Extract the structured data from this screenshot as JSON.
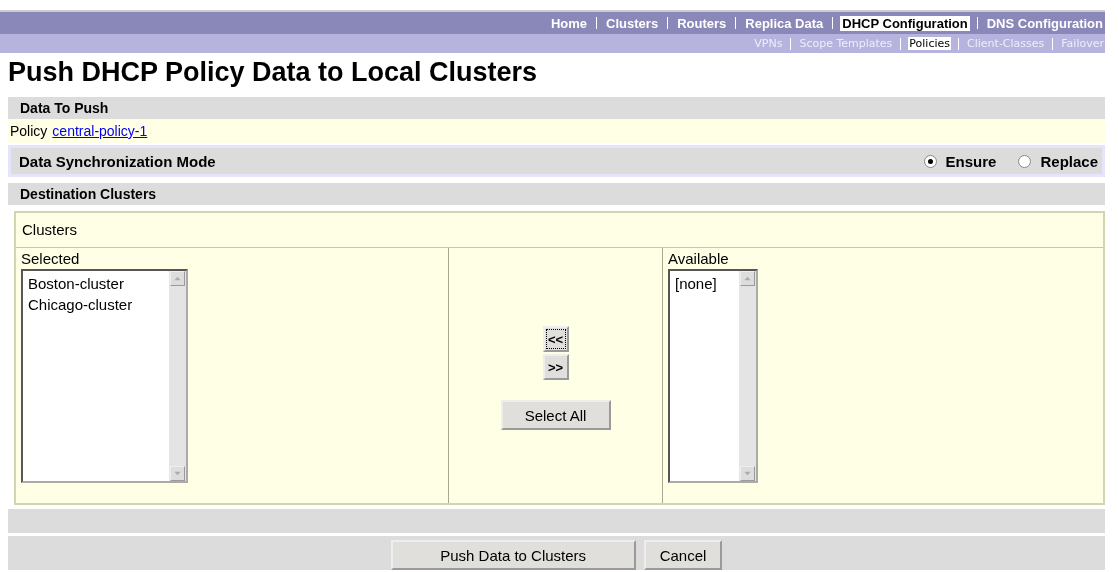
{
  "nav": {
    "items": [
      {
        "label": "Home",
        "selected": false
      },
      {
        "label": "Clusters",
        "selected": false
      },
      {
        "label": "Routers",
        "selected": false
      },
      {
        "label": "Replica Data",
        "selected": false
      },
      {
        "label": "DHCP Configuration",
        "selected": true
      },
      {
        "label": "DNS Configuration",
        "selected": false
      }
    ]
  },
  "subnav": {
    "items": [
      {
        "label": "VPNs",
        "selected": false
      },
      {
        "label": "Scope Templates",
        "selected": false
      },
      {
        "label": "Policies",
        "selected": true
      },
      {
        "label": "Client-Classes",
        "selected": false
      },
      {
        "label": "Failover",
        "selected": false
      }
    ]
  },
  "title": "Push DHCP Policy Data to Local Clusters",
  "data_section": {
    "header": "Data To Push",
    "label": "Policy",
    "link": "central-policy-1"
  },
  "sync_mode": {
    "header": "Data Synchronization Mode",
    "options": [
      {
        "label": "Ensure",
        "selected": true
      },
      {
        "label": "Replace",
        "selected": false
      }
    ]
  },
  "destination": {
    "header": "Destination Clusters",
    "legend": "Clusters",
    "selected_list": {
      "label": "Selected",
      "items": [
        "Boston-cluster",
        "Chicago-cluster"
      ]
    },
    "move_buttons": [
      "<<",
      ">>"
    ],
    "select_all": "Select All",
    "available_list": {
      "label": "Available",
      "items": [
        "[none]"
      ]
    }
  },
  "buttons": [
    "Push Data to Clusters",
    "Cancel"
  ]
}
